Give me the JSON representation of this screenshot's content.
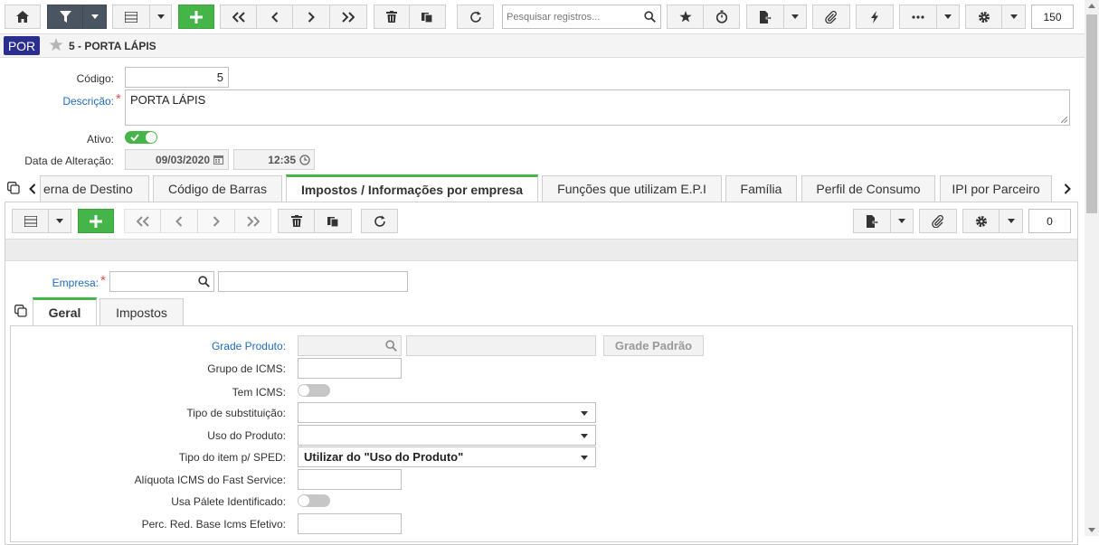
{
  "toolbar": {
    "search_placeholder": "Pesquisar registros...",
    "record_count": "150"
  },
  "header": {
    "badge": "POR",
    "title": "5 - PORTA LÁPIS"
  },
  "form": {
    "codigo_label": "Código:",
    "codigo_value": "5",
    "descricao_label": "Descrição:",
    "descricao_value": "PORTA LÁPIS",
    "ativo_label": "Ativo:",
    "data_label": "Data de Alteração:",
    "data_value": "09/03/2020",
    "hora_value": "12:35"
  },
  "tabs": [
    {
      "label": "erna de Destino"
    },
    {
      "label": "Código de Barras"
    },
    {
      "label": "Impostos / Informações por empresa"
    },
    {
      "label": "Funções que utilizam E.P.I"
    },
    {
      "label": "Família"
    },
    {
      "label": "Perfil de Consumo"
    },
    {
      "label": "IPI por Parceiro"
    }
  ],
  "subtoolbar": {
    "record_count": "0"
  },
  "empresa": {
    "label": "Empresa:"
  },
  "subtabs": [
    {
      "label": "Geral"
    },
    {
      "label": "Impostos"
    }
  ],
  "geral": {
    "grade_produto_label": "Grade Produto:",
    "grade_padrao_button": "Grade Padrão",
    "grupo_icms_label": "Grupo de ICMS:",
    "tem_icms_label": "Tem ICMS:",
    "tipo_subst_label": "Tipo de substituição:",
    "uso_produto_label": "Uso do Produto:",
    "tipo_item_label": "Tipo do item p/ SPED:",
    "tipo_item_value": "Utilizar do \"Uso do Produto\"",
    "aliquota_label": "Alíquota ICMS do Fast Service:",
    "usa_palete_label": "Usa Pálete Identificado:",
    "perc_red_label": "Perc. Red. Base Icms Efetivo:"
  },
  "colors": {
    "accent": "#45b549",
    "dark": "#4b5561",
    "badge": "#2a2f8f",
    "link": "#1f6bbf"
  }
}
